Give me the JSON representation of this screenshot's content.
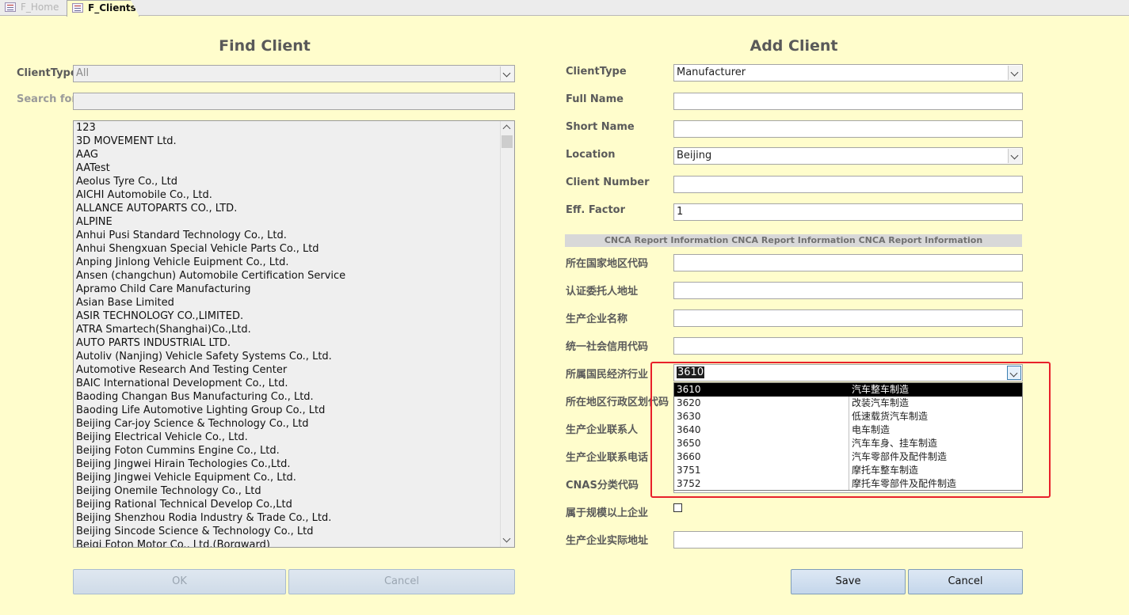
{
  "tabs": [
    {
      "label": "F_Home"
    },
    {
      "label": "F_Clients"
    }
  ],
  "find_client": {
    "title": "Find Client",
    "clienttype_label": "ClientType",
    "clienttype_value": "All",
    "search_label": "Search for",
    "search_value": "",
    "clients": [
      "123",
      "3D MOVEMENT Ltd.",
      "AAG",
      "AATest",
      "Aeolus Tyre Co., Ltd",
      "AICHI Automobile Co., Ltd.",
      "ALLANCE AUTOPARTS CO., LTD.",
      "ALPINE",
      "Anhui Pusi Standard Technology Co., Ltd.",
      "Anhui Shengxuan Special Vehicle Parts Co., Ltd",
      "Anping Jinlong Vehicle Euipment Co., Ltd.",
      "Ansen (changchun) Automobile Certification Service",
      "Apramo Child Care Manufacturing",
      "Asian Base Limited",
      "ASIR TECHNOLOGY CO.,LIMITED.",
      "ATRA Smartech(Shanghai)Co.,Ltd.",
      "AUTO PARTS INDUSTRIAL LTD.",
      "Autoliv (Nanjing) Vehicle Safety Systems Co., Ltd.",
      "Automotive Research And Testing Center",
      "BAIC International Development Co., Ltd.",
      "Baoding Changan Bus Manufacturing Co., Ltd.",
      "Baoding Life Automotive Lighting Group Co., Ltd",
      "Beijing Car-joy Science & Technology Co., Ltd",
      "Beijing Electrical Vehicle Co., Ltd.",
      "Beijing Foton Cummins Engine Co., Ltd.",
      "Beijing Jingwei Hirain Techologies Co.,Ltd.",
      "Beijing Jingwei Vehicle Equipment Co., Ltd.",
      "Beijing Onemile Technology Co., Ltd",
      "Beijing Rational Technical Develop Co.,Ltd",
      "Beijing Shenzhou Rodia Industry & Trade Co., Ltd.",
      "Beijing Sincode Science & Technology Co., Ltd",
      "Beiqi Foton Motor Co., Ltd.(Borgward)"
    ],
    "ok_label": "OK",
    "cancel_label": "Cancel"
  },
  "add_client": {
    "title": "Add Client",
    "clienttype_label": "ClientType",
    "clienttype_value": "Manufacturer",
    "fullname_label": "Full Name",
    "fullname_value": "",
    "shortname_label": "Short Name",
    "shortname_value": "",
    "location_label": "Location",
    "location_value": "Beijing",
    "clientnumber_label": "Client Number",
    "clientnumber_value": "",
    "efffactor_label": "Eff. Factor",
    "efffactor_value": "1",
    "banner": "CNCA Report Information CNCA Report Information CNCA Report Information",
    "country_label": "所在国家地区代码",
    "entrust_addr_label": "认证委托人地址",
    "producer_name_label": "生产企业名称",
    "credit_code_label": "统一社会信用代码",
    "industry_label": "所属国民经济行业",
    "industry_value": "3610",
    "region_label": "所在地区行政区划代码",
    "contact_label": "生产企业联系人",
    "phone_label": "生产企业联系电话",
    "cnas_label": "CNAS分类代码",
    "scale_label": "属于规模以上企业",
    "scale_checked": false,
    "actual_addr_label": "生产企业实际地址",
    "save_label": "Save",
    "cancel_label": "Cancel"
  },
  "industry_dropdown": [
    {
      "code": "3610",
      "name": "汽车整车制造",
      "selected": true
    },
    {
      "code": "3620",
      "name": "改装汽车制造"
    },
    {
      "code": "3630",
      "name": "低速载货汽车制造"
    },
    {
      "code": "3640",
      "name": "电车制造"
    },
    {
      "code": "3650",
      "name": "汽车车身、挂车制造"
    },
    {
      "code": "3660",
      "name": "汽车零部件及配件制造"
    },
    {
      "code": "3751",
      "name": "摩托车整车制造"
    },
    {
      "code": "3752",
      "name": "摩托车零部件及配件制造"
    }
  ],
  "colors": {
    "background": "#fffdcc",
    "highlight_box": "#e8202a"
  }
}
